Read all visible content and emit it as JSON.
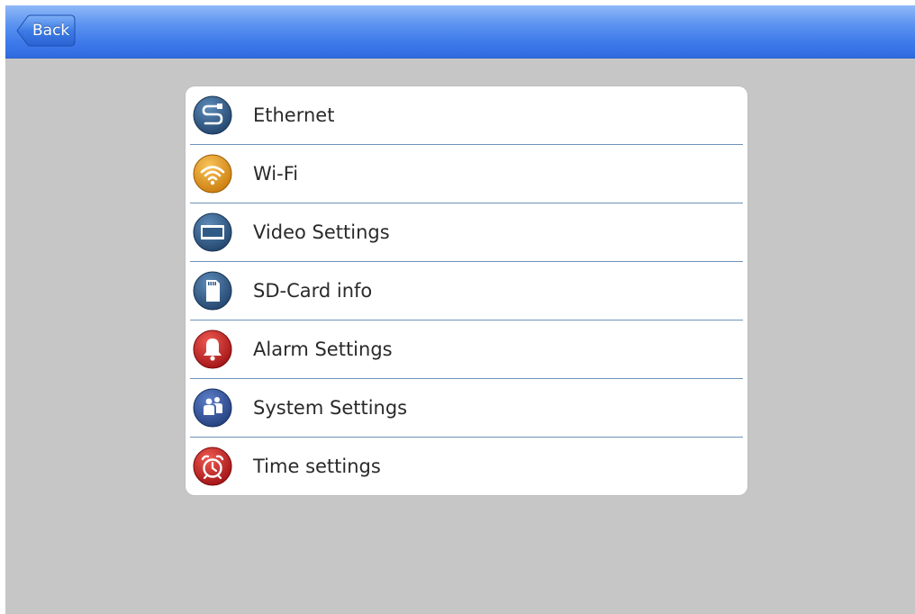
{
  "header": {
    "back_label": "Back"
  },
  "menu": {
    "items": [
      {
        "label": "Ethernet",
        "icon": "ethernet-icon",
        "color": "#2f5b86"
      },
      {
        "label": "Wi-Fi",
        "icon": "wifi-icon",
        "color": "#e49a1c"
      },
      {
        "label": "Video Settings",
        "icon": "video-settings-icon",
        "color": "#2f5b86"
      },
      {
        "label": "SD-Card info",
        "icon": "sd-card-icon",
        "color": "#2f5b86"
      },
      {
        "label": "Alarm Settings",
        "icon": "alarm-bell-icon",
        "color": "#c8191b"
      },
      {
        "label": "System Settings",
        "icon": "system-settings-icon",
        "color": "#2f5b86"
      },
      {
        "label": "Time settings",
        "icon": "alarm-clock-icon",
        "color": "#c8191b"
      }
    ]
  },
  "colors": {
    "header_blue": "#3f7bea",
    "background": "#c6c6c6",
    "divider": "#6f93b9"
  }
}
